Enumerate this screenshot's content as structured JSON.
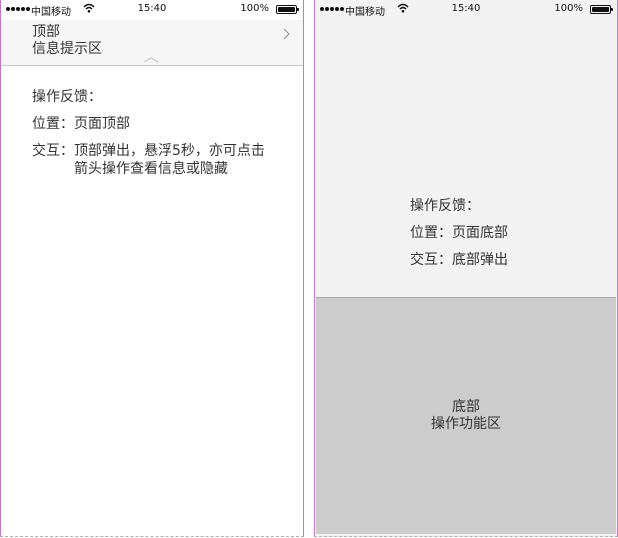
{
  "status_bar": {
    "carrier": "中国移动",
    "time": "15:40",
    "battery": "100%",
    "battery_level": 1.0
  },
  "left": {
    "banner": {
      "title": "顶部",
      "subtitle": "信息提示区"
    },
    "description": {
      "heading": "操作反馈：",
      "position_key": "位置：",
      "position_value": "页面顶部",
      "interaction_key": "交互：",
      "interaction_value": "顶部弹出，悬浮5秒，亦可点击箭头操作查看信息或隐藏"
    }
  },
  "right": {
    "description": {
      "heading": "操作反馈：",
      "position_key": "位置：",
      "position_value": "页面底部",
      "interaction_key": "交互：",
      "interaction_value": "底部弹出"
    },
    "bottom_panel": {
      "title": "底部",
      "subtitle": "操作功能区"
    }
  }
}
